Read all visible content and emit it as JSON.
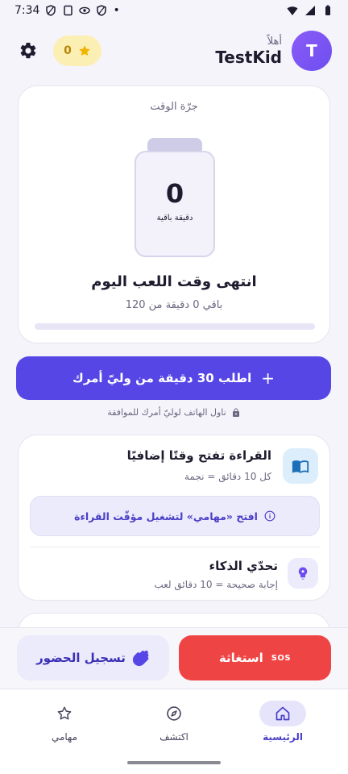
{
  "status_bar": {
    "time": "7:34",
    "dot": "•"
  },
  "header": {
    "avatar_letter": "T",
    "greeting": "أهلاً",
    "username": "TestKid",
    "stars_count": "0"
  },
  "time_jar": {
    "title": "جرّة الوقت",
    "minutes_value": "0",
    "minutes_unit": "دقيقة باقية",
    "headline": "انتهى وقت اللعب اليوم",
    "remaining_text": "باقي 0 دقيقة من 120",
    "progress_fraction": 0
  },
  "request": {
    "label": "اطلب 30 دقيقة من وليّ أمرك",
    "plus": "+",
    "hint": "ناول الهاتف لوليّ أمرك للموافقة"
  },
  "rewards": {
    "reading_title": "القراءة تفتح وقتًا إضافيًا",
    "reading_sub": "كل 10 دقائق = نجمة",
    "open_tasks_label": "افتح «مهامي» لتشغيل مؤقّت القراءة",
    "quiz_title": "تحدّي الذكاء",
    "quiz_sub": "إجابة صحيحة = 10 دقائق لعب"
  },
  "actions": {
    "sos_label": "استغاثة",
    "sos_tag": "SOS",
    "attendance_label": "تسجيل الحضور"
  },
  "nav": {
    "home": "الرئيسية",
    "explore": "اكتشف",
    "tasks": "مهامي"
  },
  "colors": {
    "primary": "#5646e6",
    "danger": "#ef4444",
    "star": "#f0b400",
    "avatar": "#7c5cf5"
  },
  "icons": {
    "settings": "gear-icon",
    "star": "star-icon",
    "book": "book-icon",
    "brain": "brain-icon",
    "info": "info-icon",
    "lock": "lock-icon",
    "wave": "waving-hand-icon",
    "home": "home-icon",
    "explore": "compass-icon",
    "tasks": "star-outline-icon"
  }
}
